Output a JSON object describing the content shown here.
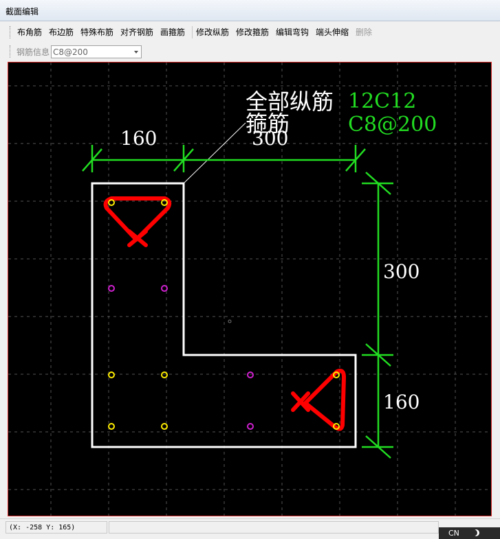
{
  "window": {
    "title": "截面编辑"
  },
  "toolbar1": [
    {
      "id": "corner",
      "label": "布角筋"
    },
    {
      "id": "edge",
      "label": "布边筋"
    },
    {
      "id": "special",
      "label": "特殊布筋"
    },
    {
      "id": "align",
      "label": "对齐钢筋"
    },
    {
      "id": "stirrup",
      "label": "画箍筋"
    },
    {
      "id": "editlong",
      "label": "修改纵筋"
    },
    {
      "id": "editstirrup",
      "label": "修改箍筋"
    },
    {
      "id": "hook",
      "label": "编辑弯钩"
    },
    {
      "id": "extend",
      "label": "端头伸缩"
    },
    {
      "id": "delete",
      "label": "删除"
    }
  ],
  "toolbar2": {
    "label": "钢筋信息",
    "combo_value": "C8@200"
  },
  "drawing": {
    "dim_top_left": "160",
    "dim_top_right": "300",
    "dim_right_top": "300",
    "dim_right_bottom": "160",
    "annot_long_label": "全部纵筋",
    "annot_long_value": "12C12",
    "annot_stirrup_label": "箍筋",
    "annot_stirrup_value": "C8@200",
    "colors": {
      "dimension": "#22dd22",
      "outline": "#ffffff",
      "stirrup": "#ff0000",
      "corner_bar": "#ffee00",
      "edge_bar": "#d020d0",
      "annot_value": "#22dd22"
    }
  },
  "status": {
    "coords": "(X: -258 Y: 165)"
  },
  "ime": {
    "lang": "CN"
  }
}
